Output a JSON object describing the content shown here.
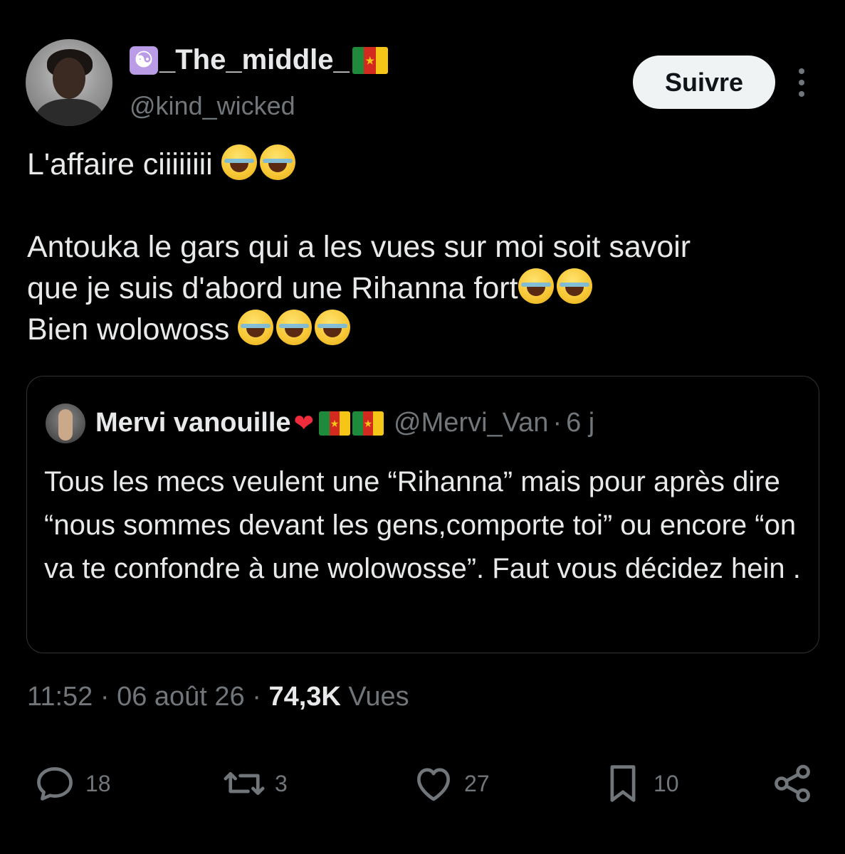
{
  "author": {
    "display_name": "_The_middle_",
    "handle": "@kind_wicked",
    "avatar_icon": "profile-photo",
    "prefix_icon": "yin-yang-icon",
    "suffix_icon": "cameroon-flag-icon"
  },
  "follow_button": {
    "label": "Suivre"
  },
  "tweet": {
    "line1": "L'affaire ciiiiiiii",
    "line2": "Antouka le gars qui a les vues sur moi soit savoir",
    "line3": "que je suis d'abord une Rihanna fort",
    "line4": "Bien wolowoss"
  },
  "quote": {
    "name": "Mervi vanouille",
    "handle": "@Mervi_Van",
    "age": "6 j",
    "separator": "·",
    "text": "Tous les mecs veulent une “Rihanna” mais pour après dire “nous sommes devant les gens,comporte toi” ou encore “on va te confondre à une wolowosse”. Faut vous décidez hein ."
  },
  "meta": {
    "time": "11:52",
    "date": "06 août 26",
    "views_count": "74,3K",
    "views_label": "Vues",
    "separator": "·"
  },
  "actions": {
    "replies": "18",
    "reposts": "3",
    "likes": "27",
    "bookmarks": "10"
  },
  "colors": {
    "background": "#000000",
    "text": "#e7e9ea",
    "muted": "#71767b",
    "border": "#2f3336",
    "button_bg": "#eff3f4"
  }
}
